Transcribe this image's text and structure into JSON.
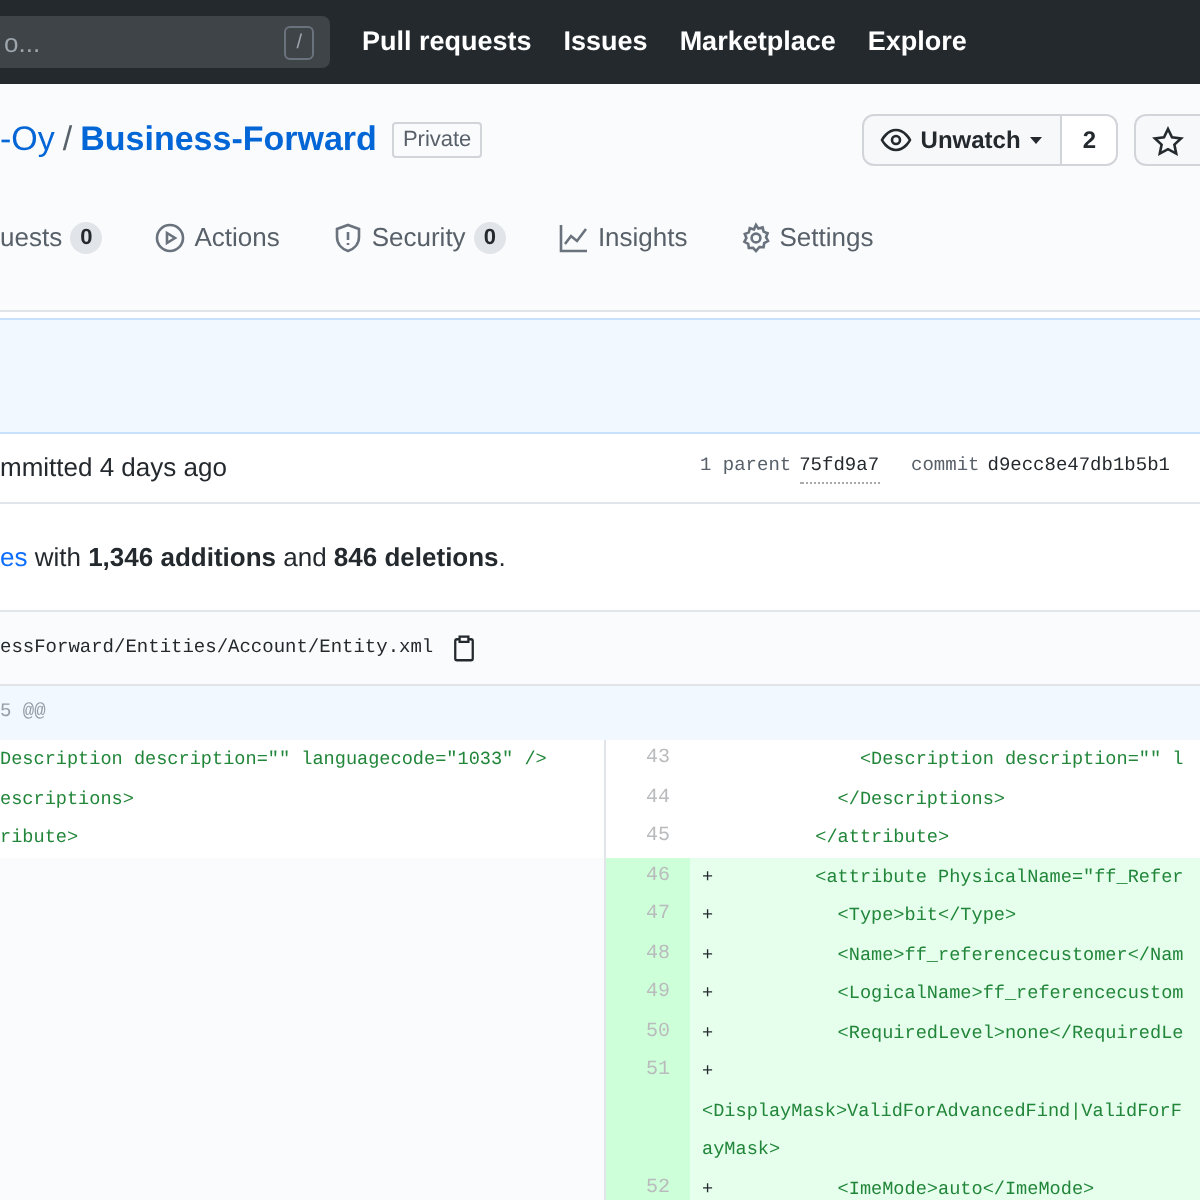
{
  "header": {
    "search": {
      "placeholder": "o...",
      "shortcut_key": "/"
    },
    "nav_links": [
      "Pull requests",
      "Issues",
      "Marketplace",
      "Explore"
    ]
  },
  "repo": {
    "owner": "-Oy",
    "separator": "/",
    "name": "Business-Forward",
    "visibility": "Private",
    "watch_button": {
      "label": "Unwatch",
      "count": "2"
    },
    "tabs": [
      {
        "kind": "pulls",
        "label": "uests",
        "count": "0",
        "selected": false
      },
      {
        "kind": "actions",
        "label": "Actions",
        "selected": false
      },
      {
        "kind": "security",
        "label": "Security",
        "count": "0",
        "selected": false
      },
      {
        "kind": "insights",
        "label": "Insights",
        "selected": false
      },
      {
        "kind": "settings",
        "label": "Settings",
        "selected": false
      }
    ]
  },
  "commit": {
    "committed": "mmitted 4 days ago",
    "parent_label": "1 parent",
    "parent_sha": "75fd9a7",
    "commit_label": "commit",
    "commit_sha": "d9ecc8e47db1b5b1"
  },
  "summary": {
    "link": "es",
    "text": " with **1,346 additions** and **846 deletions**."
  },
  "file": {
    "path": "essForward/Entities/Account/Entity.xml",
    "hunk_header": "5 @@",
    "left_lines": [
      {
        "code": "Description description=\"\" languagecode=\"1033\" />"
      },
      {
        "code": "escriptions>"
      },
      {
        "code": "ribute>"
      }
    ],
    "right_lines": [
      {
        "number": "43",
        "kind": "context",
        "code": "            <Description description=\"\" l"
      },
      {
        "number": "44",
        "kind": "context",
        "code": "          </Descriptions>"
      },
      {
        "number": "45",
        "kind": "context",
        "code": "        </attribute>"
      },
      {
        "number": "46",
        "kind": "addition",
        "marker": "+",
        "code": "        <attribute PhysicalName=\"ff_Refer"
      },
      {
        "number": "47",
        "kind": "addition",
        "marker": "+",
        "code": "          <Type>bit</Type>"
      },
      {
        "number": "48",
        "kind": "addition",
        "marker": "+",
        "code": "          <Name>ff_referencecustomer</Nam"
      },
      {
        "number": "49",
        "kind": "addition",
        "marker": "+",
        "code": "          <LogicalName>ff_referencecustom"
      },
      {
        "number": "50",
        "kind": "addition",
        "marker": "+",
        "code": "          <RequiredLevel>none</RequiredLe"
      },
      {
        "number": "51",
        "kind": "addition",
        "marker": "+",
        "code_lines": [
          "<DisplayMask>ValidForAdvancedFind|ValidForF",
          "ayMask>"
        ]
      },
      {
        "number": "52",
        "kind": "addition",
        "marker": "+",
        "code": "          <ImeMode>auto</ImeMode>"
      }
    ]
  }
}
